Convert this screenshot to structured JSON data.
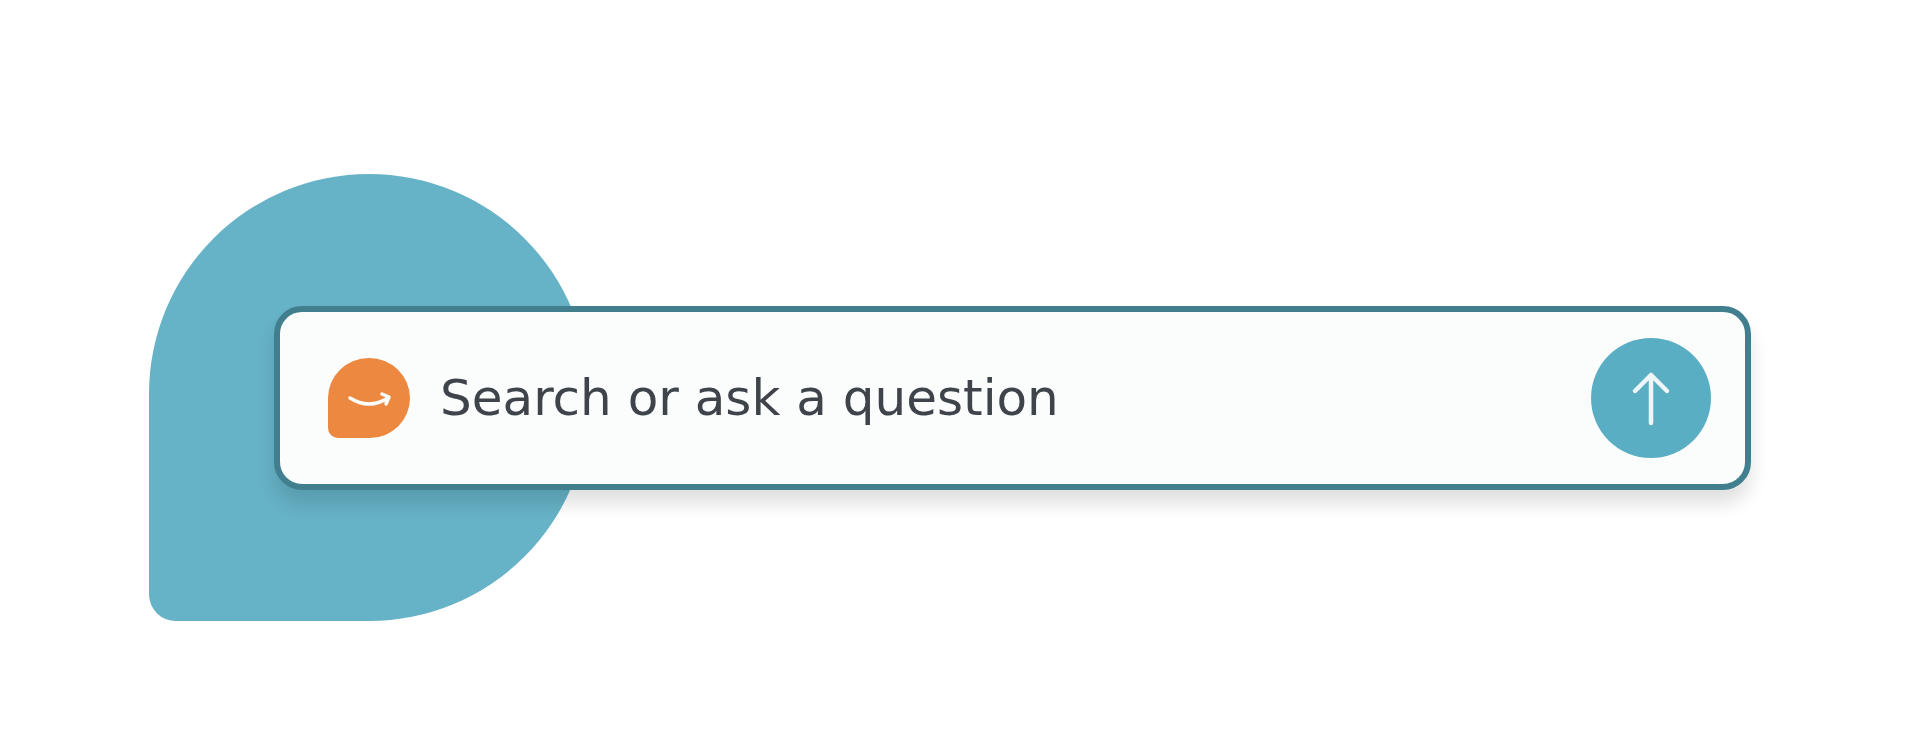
{
  "search": {
    "placeholder": "Search or ask a question"
  }
}
